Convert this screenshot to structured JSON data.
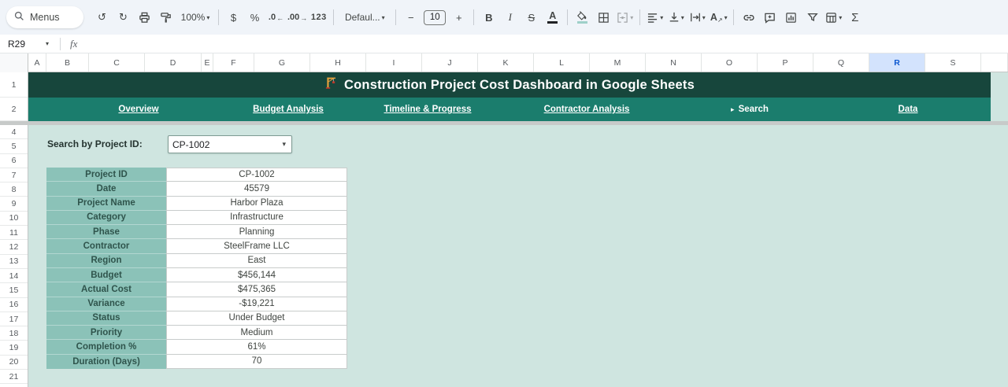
{
  "toolbar": {
    "menus": "Menus",
    "zoom": "100%",
    "font": "Defaul...",
    "font_size": "10",
    "glyphs": {
      "undo": "↺",
      "redo": "↻",
      "currency": "$",
      "percent": "%",
      "decrease_decimal": ".0",
      "decrease_arrow": "←",
      "increase_decimal": ".00",
      "increase_arrow": "→",
      "more_formats": "123",
      "minus": "−",
      "plus": "+",
      "bold": "B",
      "italic": "I",
      "strikethrough": "S",
      "text_color": "A",
      "text_rotation": "A",
      "rotation_arrow": "↗",
      "functions": "Σ",
      "caret": "▾"
    }
  },
  "formula_bar": {
    "name_box": "R29",
    "fx_label": "fx",
    "caret": "▾"
  },
  "sheet": {
    "columns": [
      "A",
      "B",
      "C",
      "D",
      "E",
      "F",
      "G",
      "H",
      "I",
      "J",
      "K",
      "L",
      "M",
      "N",
      "O",
      "P",
      "Q",
      "R",
      "S"
    ],
    "selected_column": "R",
    "row_numbers": [
      "1",
      "2",
      "4",
      "5",
      "6",
      "7",
      "8",
      "9",
      "10",
      "11",
      "12",
      "13",
      "14",
      "15",
      "16",
      "17",
      "18",
      "19",
      "20",
      "21"
    ]
  },
  "banner": {
    "icon": "construction-crane",
    "title": "Construction Project Cost Dashboard in Google Sheets"
  },
  "nav": {
    "items": [
      {
        "label": "Overview"
      },
      {
        "label": "Budget Analysis"
      },
      {
        "label": "Timeline & Progress"
      },
      {
        "label": "Contractor Analysis"
      },
      {
        "label": "Search",
        "prefix": "▸",
        "current": true
      },
      {
        "label": "Data"
      }
    ]
  },
  "search_panel": {
    "label": "Search by Project ID:",
    "value": "CP-1002",
    "caret": "▾"
  },
  "detail_table": {
    "rows": [
      {
        "label": "Project ID",
        "value": "CP-1002"
      },
      {
        "label": "Date",
        "value": "45579"
      },
      {
        "label": "Project Name",
        "value": "Harbor Plaza"
      },
      {
        "label": "Category",
        "value": "Infrastructure"
      },
      {
        "label": "Phase",
        "value": "Planning"
      },
      {
        "label": "Contractor",
        "value": "SteelFrame LLC"
      },
      {
        "label": "Region",
        "value": "East"
      },
      {
        "label": "Budget",
        "value": "$456,144"
      },
      {
        "label": "Actual Cost",
        "value": "$475,365"
      },
      {
        "label": "Variance",
        "value": "-$19,221"
      },
      {
        "label": "Status",
        "value": "Under Budget"
      },
      {
        "label": "Priority",
        "value": "Medium"
      },
      {
        "label": "Completion %",
        "value": "61%"
      },
      {
        "label": "Duration (Days)",
        "value": "70"
      }
    ]
  },
  "colors": {
    "banner_bg": "#17463c",
    "nav_bg": "#1b7d6d",
    "canvas_bg": "#cfe5e0",
    "table_label_bg": "#8bc2b8",
    "table_label_text": "#2f544c",
    "selected_col_bg": "#d3e3fd",
    "selected_col_text": "#0b57d0",
    "accent_teal": "#9fd0c9"
  }
}
